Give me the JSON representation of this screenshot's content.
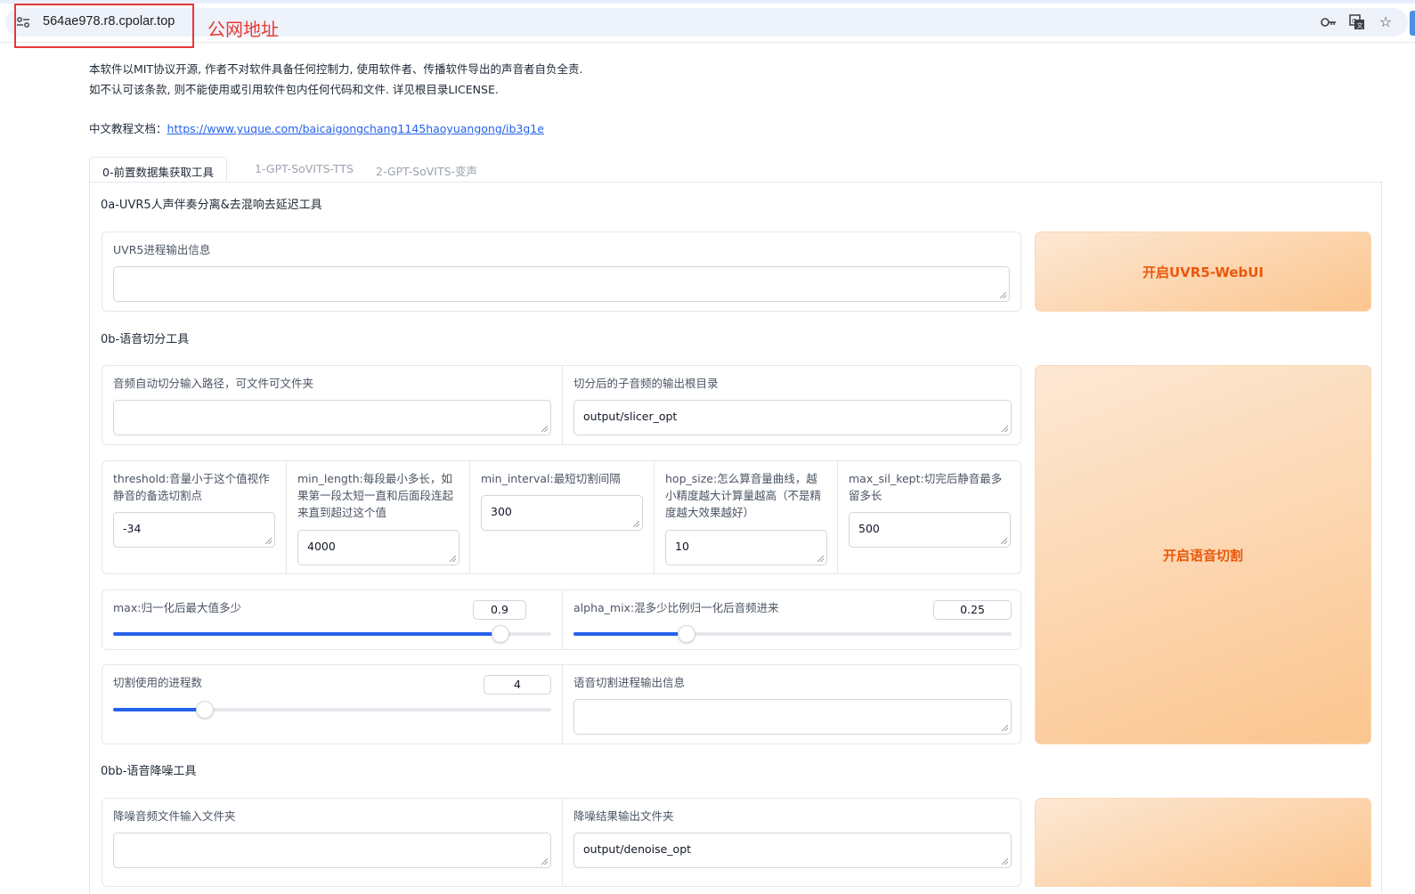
{
  "browser": {
    "url": "564ae978.r8.cpolar.top",
    "annotation": "公网地址"
  },
  "intro": {
    "line1": "本软件以MIT协议开源, 作者不对软件具备任何控制力, 使用软件者、传播软件导出的声音者自负全责.",
    "line2": "如不认可该条款, 则不能使用或引用软件包内任何代码和文件. 详见根目录LICENSE.",
    "doc_label": "中文教程文档：",
    "doc_link": "https://www.yuque.com/baicaigongchang1145haoyuangong/ib3g1e"
  },
  "tabs": [
    {
      "label": "0-前置数据集获取工具",
      "active": true
    },
    {
      "label": "1-GPT-SoVITS-TTS",
      "active": false
    },
    {
      "label": "2-GPT-SoVITS-变声",
      "active": false
    }
  ],
  "uvr5": {
    "title": "0a-UVR5人声伴奏分离&去混响去延迟工具",
    "output_label": "UVR5进程输出信息",
    "output_value": "",
    "button": "开启UVR5-WebUI"
  },
  "slicer": {
    "title": "0b-语音切分工具",
    "input_label": "音频自动切分输入路径，可文件可文件夹",
    "input_value": "",
    "output_label": "切分后的子音频的输出根目录",
    "output_value": "output/slicer_opt",
    "threshold_label": "threshold:音量小于这个值视作静音的备选切割点",
    "threshold_value": "-34",
    "min_length_label": "min_length:每段最小多长，如果第一段太短一直和后面段连起来直到超过这个值",
    "min_length_value": "4000",
    "min_interval_label": "min_interval:最短切割间隔",
    "min_interval_value": "300",
    "hop_size_label": "hop_size:怎么算音量曲线，越小精度越大计算量越高（不是精度越大效果越好）",
    "hop_size_value": "10",
    "max_sil_label": "max_sil_kept:切完后静音最多留多长",
    "max_sil_value": "500",
    "max_label": "max:归一化后最大值多少",
    "max_value": "0.9",
    "max_fraction": 0.885,
    "alpha_label": "alpha_mix:混多少比例归一化后音频进来",
    "alpha_value": "0.25",
    "alpha_fraction": 0.258,
    "procs_label": "切割使用的进程数",
    "procs_value": "4",
    "procs_fraction": 0.21,
    "info_label": "语音切割进程输出信息",
    "info_value": "",
    "button": "开启语音切割"
  },
  "denoise": {
    "title": "0bb-语音降噪工具",
    "input_label": "降噪音频文件输入文件夹",
    "input_value": "",
    "output_label": "降噪结果输出文件夹",
    "output_value": "output/denoise_opt"
  },
  "icons": {
    "site": "site-settings-icon",
    "key": "key-icon",
    "translate": "translate-icon",
    "star": "star-icon"
  },
  "colors": {
    "accent": "#2563eb",
    "button_text": "#ea580c",
    "annotation": "#e53935"
  }
}
